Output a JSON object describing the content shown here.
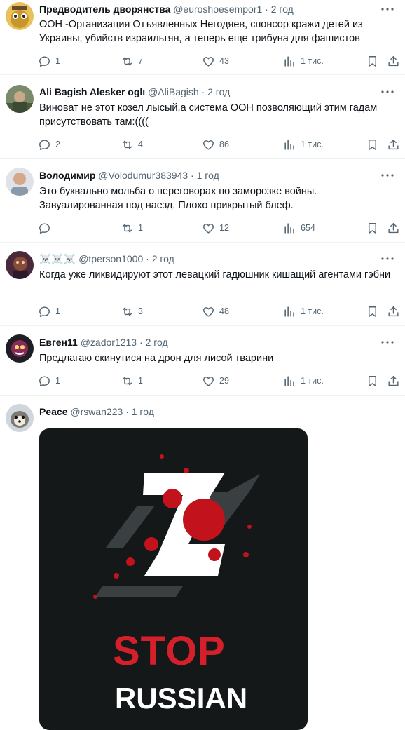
{
  "tweets": [
    {
      "name": "Предводитель дворянства",
      "handle": "@euroshoesempor1",
      "time": "2 год",
      "text": "ООН -Организация Отъявленных Негодяев, спонсор кражи детей из Украины, убийств израильтян, а теперь еще трибуна для фашистов",
      "replies": "1",
      "reposts": "7",
      "likes": "43",
      "views": "1 тис."
    },
    {
      "name": "Ali Bagish Alesker oglı",
      "handle": "@AliBagish",
      "time": "2 год",
      "text": "Виноват не этот козел лысый,а система  ООН позволяющий этим гадам присутствовать там:((((",
      "replies": "2",
      "reposts": "4",
      "likes": "86",
      "views": "1 тис."
    },
    {
      "name": "Володимир",
      "handle": "@Volodumur383943",
      "time": "1 год",
      "text": "Это буквально мольба о переговорах по заморозке войны. Завуалированная под наезд. Плохо прикрытый блеф.",
      "replies": "",
      "reposts": "1",
      "likes": "12",
      "views": "654"
    },
    {
      "name": "☠️☠️☠️",
      "handle": "@tperson1000",
      "time": "2 год",
      "text": "Когда уже ликвидируют этот левацкий гадюшник кишащий агентами гэбни",
      "replies": "1",
      "reposts": "3",
      "likes": "48",
      "views": "1 тис."
    },
    {
      "name": "Евген11",
      "handle": "@zador1213",
      "time": "2 год",
      "text": "Предлагаю скинутися на дрон для лисой тварини",
      "replies": "1",
      "reposts": "1",
      "likes": "29",
      "views": "1 тис."
    },
    {
      "name": "Peace",
      "handle": "@rswan223",
      "time": "1 год",
      "image": {
        "line1": "STOP",
        "line2": "RUSSIAN"
      }
    }
  ],
  "colors": {
    "text": "#0f1419",
    "secondary": "#536471",
    "divider": "#eff3f4",
    "stop_red": "#d4202a"
  },
  "icons": {
    "reply": "reply-icon",
    "repost": "repost-icon",
    "like": "heart-icon",
    "views": "views-chart-icon",
    "bookmark": "bookmark-icon",
    "share": "share-icon",
    "more": "more-dots-icon"
  }
}
